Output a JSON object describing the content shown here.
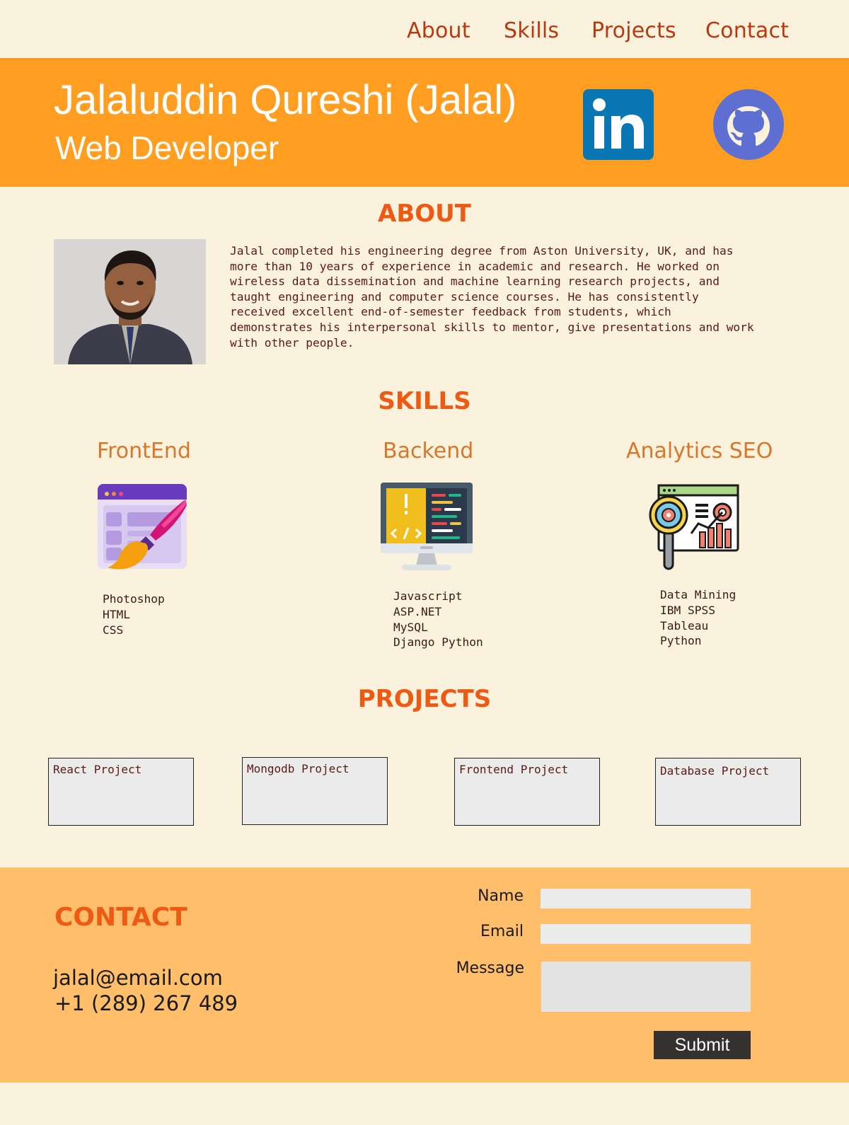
{
  "nav": {
    "items": [
      {
        "label": "About"
      },
      {
        "label": "Skills"
      },
      {
        "label": "Projects"
      },
      {
        "label": "Contact"
      }
    ]
  },
  "header": {
    "name": "Jalaluddin Qureshi (Jalal)",
    "role": "Web Developer",
    "social": [
      "linkedin-icon",
      "github-icon"
    ],
    "background_color": "#ff9e21"
  },
  "about": {
    "title": "ABOUT",
    "text": "Jalal completed his engineering degree from Aston University, UK, and has\nmore than 10 years of experience in academic and research. He worked on\nwireless data dissemination and machine learning research projects, and\ntaught engineering and computer science courses. He has consistently\nreceived excellent end-of-semester feedback  from students, which\ndemonstrates his interpersonal skills to mentor, give presentations and work\nwith other people."
  },
  "skills": {
    "title": "SKILLS",
    "groups": [
      {
        "title": "FrontEnd",
        "icon": "web-design-brush-icon",
        "items": [
          "Photoshop",
          "HTML",
          "CSS"
        ]
      },
      {
        "title": "Backend",
        "icon": "code-monitor-icon",
        "items": [
          "Javascript",
          "ASP.NET",
          "MySQL",
          "Django Python"
        ]
      },
      {
        "title": "Analytics SEO",
        "icon": "analytics-magnifier-icon",
        "items": [
          "Data Mining",
          "IBM SPSS",
          "Tableau",
          "Python"
        ]
      }
    ]
  },
  "projects": {
    "title": "PROJECTS",
    "items": [
      {
        "label": "React Project"
      },
      {
        "label": "Mongodb Project"
      },
      {
        "label": "Frontend Project"
      },
      {
        "label": "Database Project"
      }
    ]
  },
  "contact": {
    "title": "CONTACT",
    "email": "jalal@email.com",
    "phone": "+1 (289) 267 489",
    "form": {
      "name_label": "Name",
      "email_label": "Email",
      "message_label": "Message",
      "name_value": "",
      "email_value": "",
      "message_value": "",
      "submit_label": "Submit"
    },
    "background_color": "#ffbe6a"
  },
  "colors": {
    "page_background": "#faf2dd",
    "accent": "#ee5a14",
    "nav_text": "#b8380f"
  }
}
